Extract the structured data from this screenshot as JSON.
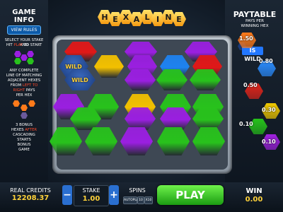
{
  "logo": {
    "letters": [
      "H",
      "E",
      "X",
      "A",
      "L",
      "I",
      "N",
      "E"
    ]
  },
  "game_info": {
    "title": "GAME INFO",
    "view_rules": "VIEW RULES",
    "line1": "SELECT YOUR STAKE AND",
    "line2_a": "HIT ",
    "line2_b": "PLAY",
    "line2_c": " TO START",
    "line3": "ANY COMPLETE",
    "line4": "LINE OF MATCHING",
    "line5": "ADJACENT HEXES",
    "line6_a": "FROM ",
    "line6_b": "LEFT TO",
    "line7_a": "RIGHT",
    "line7_b": " PAYS",
    "line8": "PER HEX",
    "line9": "3 BONUS",
    "line10_a": "HEXES ",
    "line10_b": "AFTER",
    "line11": "CASCADING",
    "line12": "STARTS",
    "line13": "BONUS",
    "line14": "GAME"
  },
  "paytable": {
    "title": "PAYTABLE",
    "sub1": "PAYS PER",
    "sub2": "WINNING HEX",
    "wild_label": "IS WILD",
    "rows": [
      {
        "value": "1.50",
        "color": "#ff7a1a"
      },
      {
        "value": "0.80",
        "color": "#2a8cff"
      },
      {
        "value": "0.50",
        "color": "#e0241a"
      },
      {
        "value": "0.30",
        "color": "#f0c800"
      },
      {
        "value": "0.10",
        "color": "#26c21a"
      },
      {
        "value": "0.10",
        "color": "#a020e0"
      }
    ]
  },
  "board": {
    "rows": [
      [
        "red",
        "purple",
        "purple"
      ],
      [
        "wild",
        "yellow",
        "purple",
        "blue",
        "red"
      ],
      [
        "wild",
        "purple",
        "green",
        "green"
      ],
      [
        "purple",
        "green",
        "yellow",
        "green",
        "green"
      ],
      [
        "green",
        "purple",
        "purple",
        "green"
      ],
      [
        "green",
        "green",
        "purple",
        "green",
        "green"
      ]
    ],
    "wild_text": "WILD",
    "colors": {
      "red": "#e01818",
      "purple": "#9a1fe0",
      "yellow": "#f2c000",
      "blue": "#1e82f0",
      "green": "#28c21c",
      "wild": "#1a3a7a"
    }
  },
  "bottom": {
    "credits_label": "REAL CREDITS",
    "credits_value": "12208.37",
    "stake_label": "STAKE",
    "stake_value": "1.00",
    "minus": "−",
    "plus": "+",
    "spins_label": "SPINS",
    "spin_options": [
      "AUTOPLAY",
      "10",
      "X10"
    ],
    "play_label": "PLAY",
    "win_label": "WIN",
    "win_value": "0.00"
  }
}
